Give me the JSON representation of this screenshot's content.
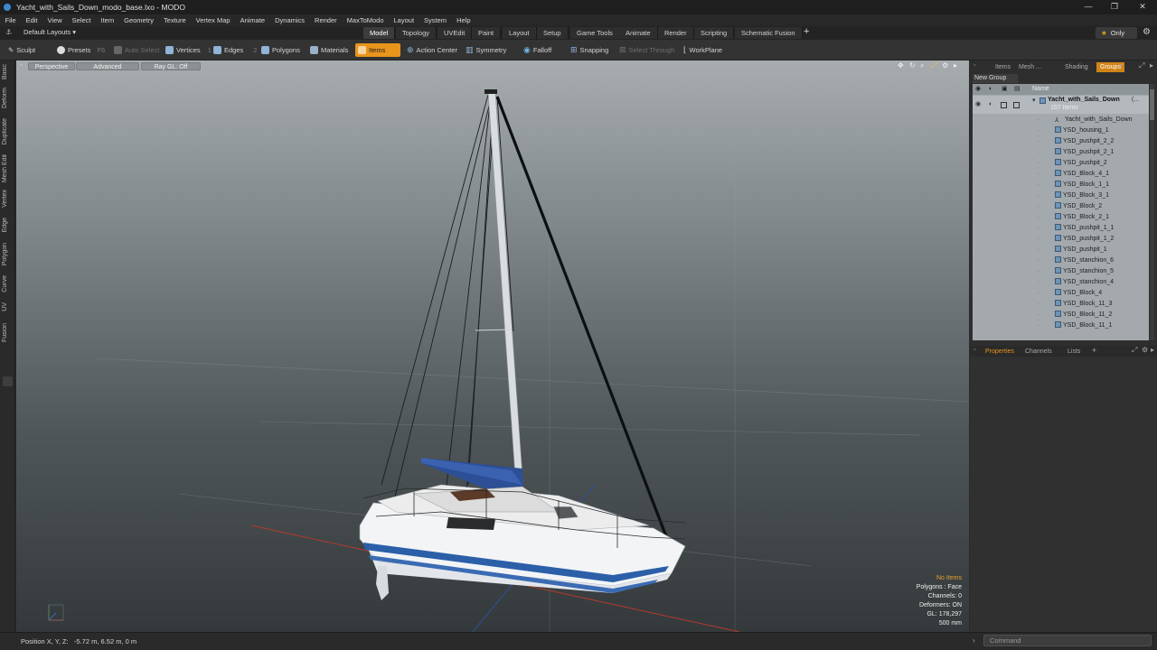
{
  "window": {
    "title": "Yacht_with_Sails_Down_modo_base.lxo - MODO",
    "controls": [
      "—",
      "❐",
      "✕"
    ]
  },
  "menu": [
    "File",
    "Edit",
    "View",
    "Select",
    "Item",
    "Geometry",
    "Texture",
    "Vertex Map",
    "Animate",
    "Dynamics",
    "Render",
    "MaxToModo",
    "Layout",
    "System",
    "Help"
  ],
  "layout_bar": {
    "layout_name": "Default Layouts ▾",
    "tabs": [
      "Model",
      "Topology",
      "UVEdit",
      "Paint",
      "Layout",
      "Setup",
      "Game Tools",
      "Animate",
      "Render",
      "Scripting",
      "Schematic Fusion"
    ],
    "active_tab": "Model",
    "add_label": "+",
    "only_label": "Only"
  },
  "toolbar": {
    "sculpt": "Sculpt",
    "presets": "Presets",
    "presets_key": "F6",
    "auto_select": "Auto Select",
    "vertices": "Vertices",
    "vertices_key": "1",
    "edges": "Edges",
    "edges_key": "2",
    "polygons": "Polygons",
    "materials": "Materials",
    "items": "Items",
    "action_center": "Action Center",
    "symmetry": "Symmetry",
    "falloff": "Falloff",
    "snapping": "Snapping",
    "select_through": "Select Through",
    "workplane": "WorkPlane"
  },
  "left_tabs": [
    "Basic",
    "Deform",
    "Duplicate",
    "Mesh Edit",
    "Vertex",
    "Edge",
    "Polygon",
    "Curve",
    "UV",
    "Fusion"
  ],
  "viewport": {
    "buttons": [
      "Perspective",
      "Advanced",
      "Ray GL: Off"
    ],
    "stats": [
      "No Items",
      "Polygons : Face",
      "Channels: 0",
      "Deformers: ON",
      "GL: 178,297",
      "500 mm"
    ]
  },
  "status": {
    "position": "Position X, Y, Z:   -5.72 m, 6.52 m, 0 m",
    "command_placeholder": "Command"
  },
  "right_panel": {
    "tabs": [
      "Items",
      "Mesh ...",
      "Shading",
      "Groups"
    ],
    "active_tab": "Groups",
    "new_group": "New Group",
    "name_header": "Name",
    "group_name": "Yacht_with_Sails_Down",
    "group_suffix": "(...",
    "group_count": "157 Items",
    "items": [
      "Yacht_with_Sails_Down",
      "YSD_housing_1",
      "YSD_pushpit_2_2",
      "YSD_pushpit_2_1",
      "YSD_pushpit_2",
      "YSD_Block_4_1",
      "YSD_Block_1_1",
      "YSD_Block_3_1",
      "YSD_Block_2",
      "YSD_Block_2_1",
      "YSD_pushpit_1_1",
      "YSD_pushpit_1_2",
      "YSD_pushpit_1",
      "YSD_stanchion_6",
      "YSD_stanchion_5",
      "YSD_stanchion_4",
      "YSD_Block_4",
      "YSD_Block_11_3",
      "YSD_Block_11_2",
      "YSD_Block_11_1"
    ],
    "bottom_tabs": [
      "Properties",
      "Channels",
      "Lists"
    ],
    "bottom_active": "Properties",
    "bottom_add": "+"
  },
  "colors": {
    "accent": "#e8951c",
    "hull_stripe": "#2b5fa8",
    "sail_cover": "#2c4f96",
    "grid_red": "#b83a2a",
    "grid_blue": "#2e4f9e"
  }
}
